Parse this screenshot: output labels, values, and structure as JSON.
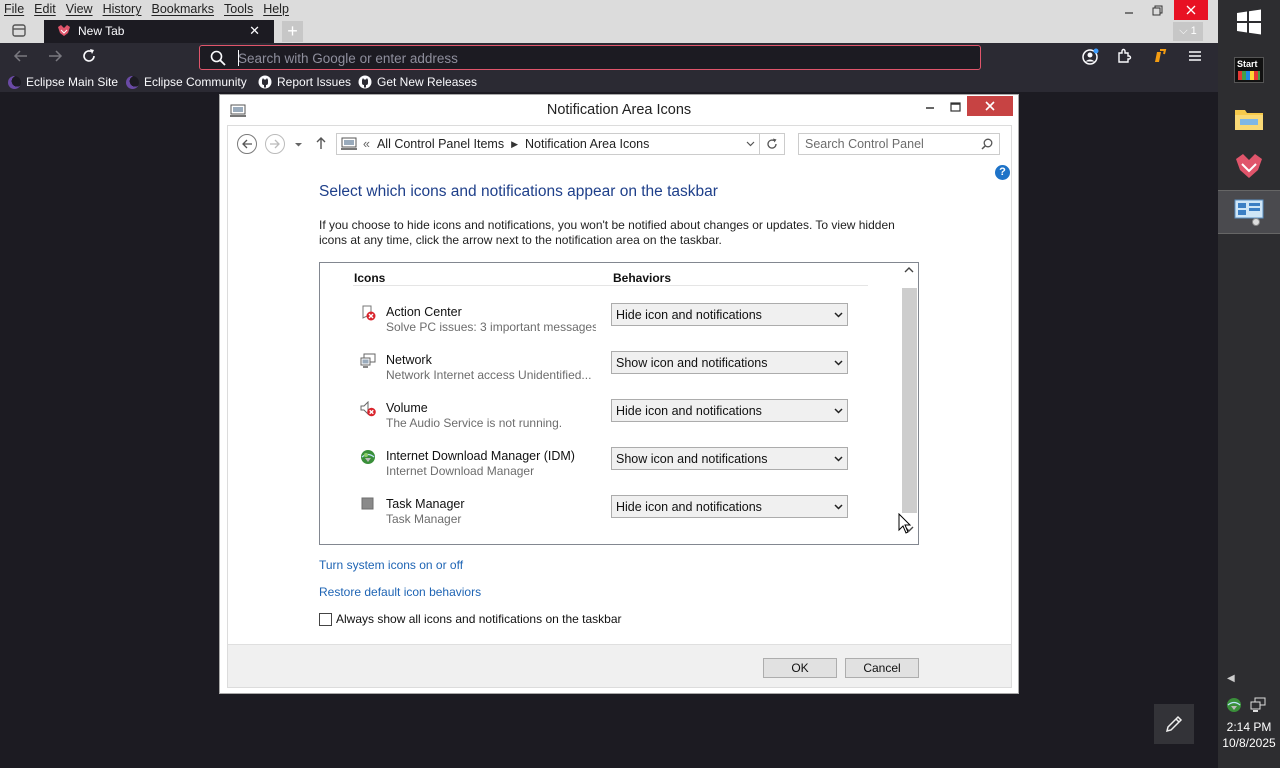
{
  "browser": {
    "menu": [
      "File",
      "Edit",
      "View",
      "History",
      "Bookmarks",
      "Tools",
      "Help"
    ],
    "tab_title": "New Tab",
    "tabs_count": "1",
    "address_placeholder": "Search with Google or enter address",
    "bookmarks": [
      "Eclipse Main Site",
      "Eclipse Community",
      "Report Issues",
      "Get New Releases"
    ]
  },
  "window": {
    "title": "Notification Area Icons",
    "breadcrumb": [
      "All Control Panel Items",
      "Notification Area Icons"
    ],
    "search_placeholder": "Search Control Panel",
    "heading": "Select which icons and notifications appear on the taskbar",
    "description": "If you choose to hide icons and notifications, you won't be notified about changes or updates. To view hidden icons at any time, click the arrow next to the notification area on the taskbar.",
    "columns": {
      "icons": "Icons",
      "behaviors": "Behaviors"
    },
    "rows": [
      {
        "name": "Action Center",
        "sub": "Solve PC issues: 3 important messages",
        "behavior": "Hide icon and notifications",
        "icon": "action-center-icon"
      },
      {
        "name": "Network",
        "sub": "Network Internet access  Unidentified...",
        "behavior": "Show icon and notifications",
        "icon": "network-icon"
      },
      {
        "name": "Volume",
        "sub": "The Audio Service is not running.",
        "behavior": "Hide icon and notifications",
        "icon": "volume-icon"
      },
      {
        "name": "Internet Download Manager (IDM)",
        "sub": "Internet Download Manager",
        "behavior": "Show icon and notifications",
        "icon": "idm-icon"
      },
      {
        "name": "Task Manager",
        "sub": "Task Manager",
        "behavior": "Hide icon and notifications",
        "icon": "task-manager-icon"
      }
    ],
    "link_system_icons": "Turn system icons on or off",
    "link_restore": "Restore default icon behaviors",
    "checkbox_label": "Always show all icons and notifications on the taskbar",
    "ok": "OK",
    "cancel": "Cancel"
  },
  "taskbar": {
    "start_label": "Start",
    "time": "2:14 PM",
    "date": "10/8/2025"
  },
  "colors": {
    "accent": "#1e64b4",
    "heading": "#1e3f8a",
    "close": "#c74343",
    "url_border": "#e0556b"
  }
}
